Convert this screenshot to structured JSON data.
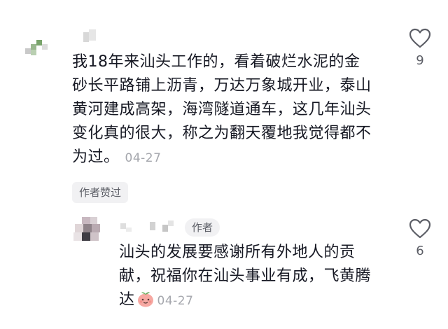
{
  "comment": {
    "lines": [
      "我18年来汕头工作的，看着破烂水泥的金",
      "砂长平路铺上沥青，万达万象城开业，泰山",
      "黄河建成高架，海湾隧道通车，这几年汕头",
      "变化真的很大，称之为翻天覆地我觉得都不",
      "为过。"
    ],
    "date": "04-27",
    "like_count": "9",
    "liked_by_author_label": "作者赞过"
  },
  "reply": {
    "author_badge": "作者",
    "lines": [
      "汕头的发展要感谢所有外地人的贡",
      "献，祝福你在汕头事业有成，飞黄腾",
      "达"
    ],
    "date": "04-27",
    "like_count": "6"
  },
  "colors": {
    "text": "#161823",
    "meta": "#a5a7ad",
    "badge_bg": "#f1f1f3",
    "icon_stroke": "#5c5e66"
  },
  "icons": [
    "heart-outline-icon",
    "peach-face-emoji"
  ]
}
